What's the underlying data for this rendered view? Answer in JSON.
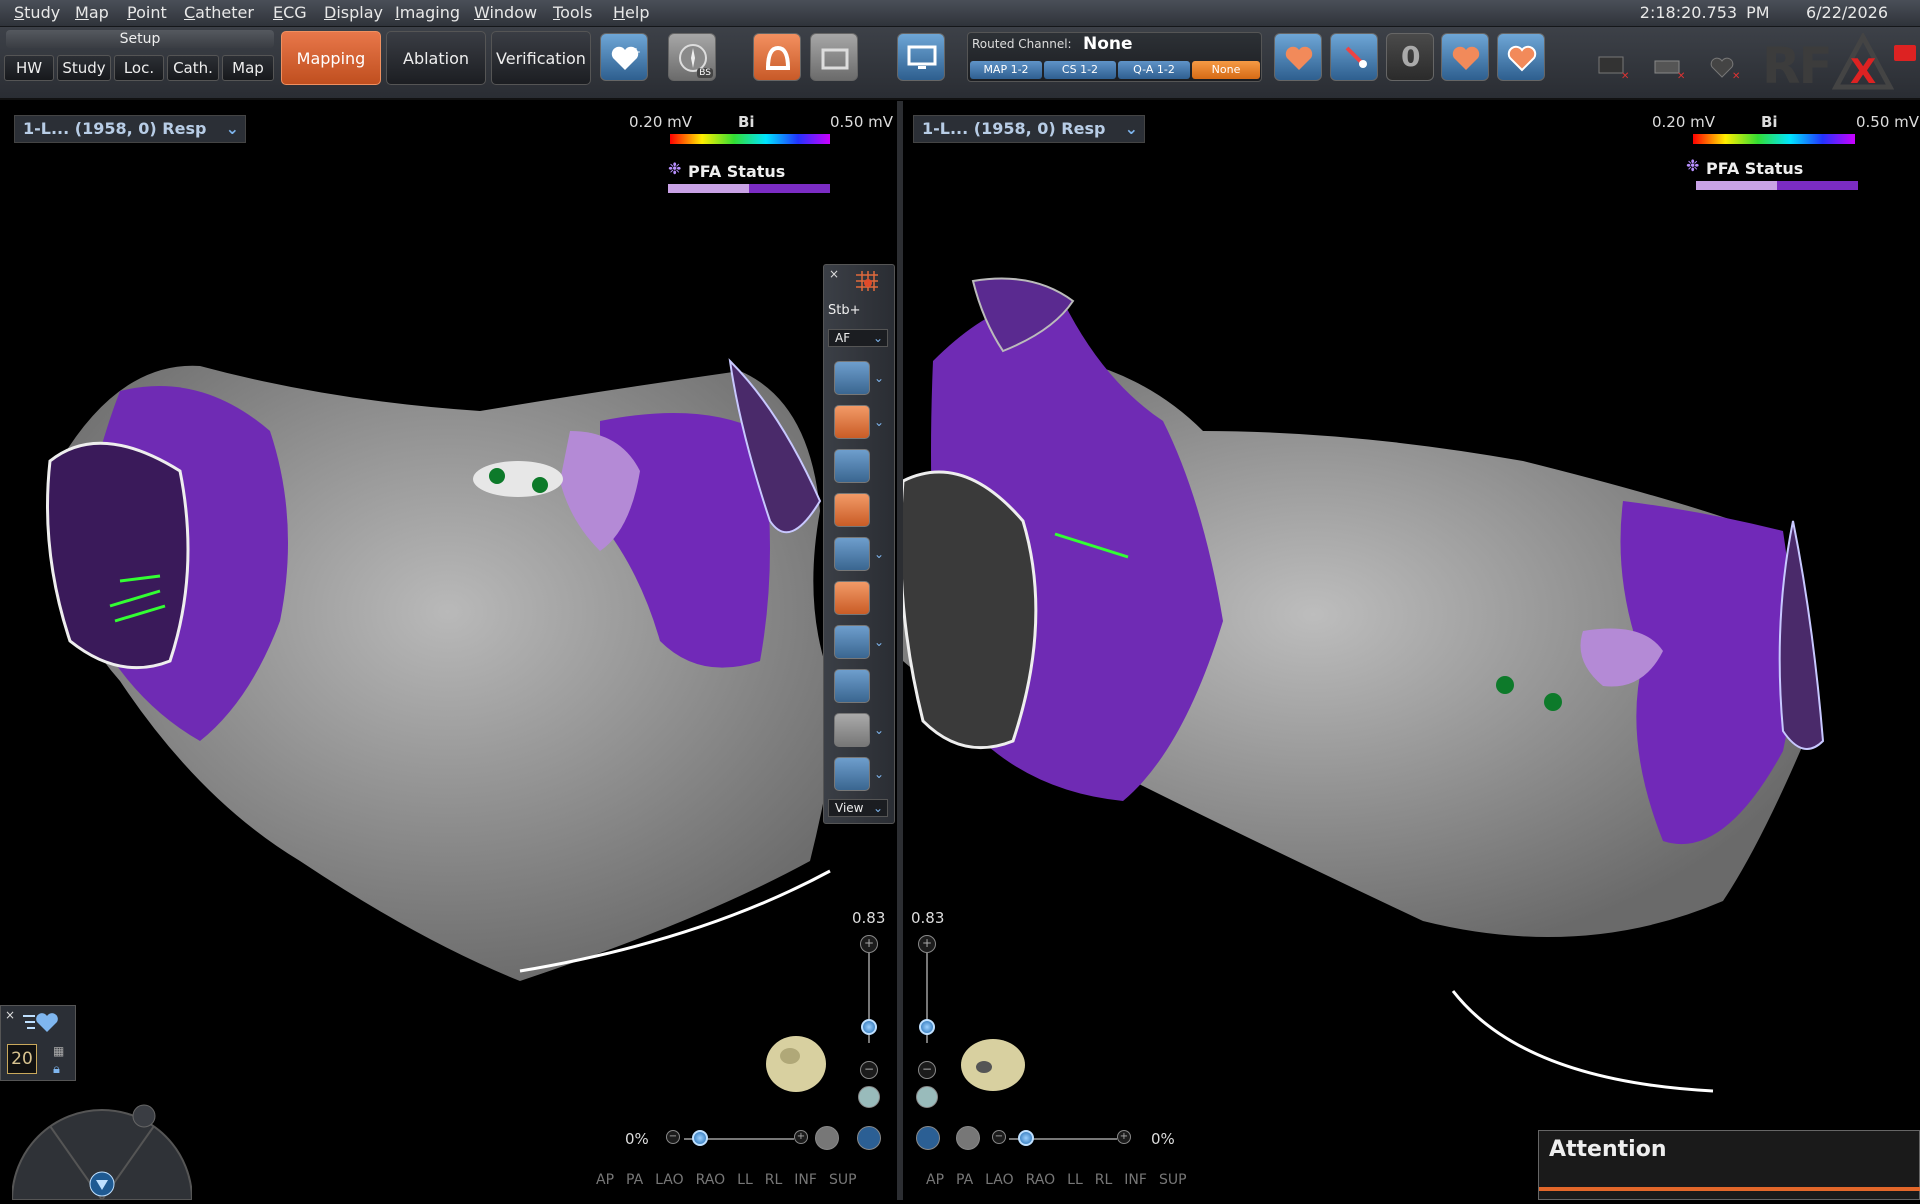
{
  "menubar": {
    "items": [
      {
        "first": "S",
        "rest": "tudy"
      },
      {
        "first": "M",
        "rest": "ap"
      },
      {
        "first": "P",
        "rest": "oint"
      },
      {
        "first": "C",
        "rest": "atheter"
      },
      {
        "first": "E",
        "rest": "CG"
      },
      {
        "first": "D",
        "rest": "isplay"
      },
      {
        "first": "I",
        "rest": "maging"
      },
      {
        "first": "W",
        "rest": "indow"
      },
      {
        "first": "T",
        "rest": "ools"
      },
      {
        "first": "H",
        "rest": "elp"
      }
    ],
    "time": "2:18:20.753 PM",
    "date": "6/22/2026"
  },
  "toolbar": {
    "setup_label": "Setup",
    "setup_buttons": [
      "HW",
      "Study",
      "Loc.",
      "Cath.",
      "Map"
    ],
    "modes": [
      "Mapping",
      "Ablation",
      "Verification"
    ],
    "active_mode": "Mapping",
    "bs_badge": "BS",
    "routed_channel_label": "Routed Channel:",
    "routed_channel_value": "None",
    "channels": [
      "MAP 1-2",
      "CS 1-2",
      "Q-A 1-2",
      "None"
    ],
    "selected_channel": "None",
    "counter": "0",
    "rf_label": "RF",
    "accent": "#d9622a",
    "selected_color": "#f08a3a"
  },
  "viewports": {
    "left": {
      "map_label": "1-L... (1958, 0) Resp",
      "cb_min": "0.20 mV",
      "cb_mid": "Bi",
      "cb_max": "0.50 mV",
      "pfa_label": "PFA Status",
      "zoom": "0.83",
      "opacity": "0%",
      "views": [
        "AP",
        "PA",
        "LAO",
        "RAO",
        "LL",
        "RL",
        "INF",
        "SUP"
      ]
    },
    "right": {
      "map_label": "1-L... (1958, 0) Resp",
      "cb_min": "0.20 mV",
      "cb_mid": "Bi",
      "cb_max": "0.50 mV",
      "pfa_label": "PFA Status",
      "zoom": "0.83",
      "opacity": "0%",
      "views": [
        "AP",
        "PA",
        "LAO",
        "RAO",
        "LL",
        "RL",
        "INF",
        "SUP"
      ]
    }
  },
  "palette": {
    "stb_label": "Stb+",
    "rhythm": "AF",
    "view_label": "View",
    "close": "×"
  },
  "step_widget": {
    "value": "20"
  },
  "attention": {
    "title": "Attention"
  },
  "colors": {
    "scar_purple": "#7a2cc0",
    "pfa_light": "#c9a2e6",
    "tissue_gray": "#9a9a9a"
  }
}
